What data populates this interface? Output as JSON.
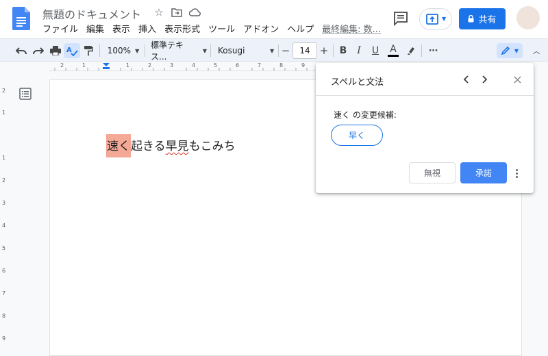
{
  "app": {
    "title": "無題のドキュメント",
    "menu": [
      "ファイル",
      "編集",
      "表示",
      "挿入",
      "表示形式",
      "ツール",
      "アドオン",
      "ヘルプ"
    ],
    "last_edit": "最終編集: 数...",
    "share_label": "共有",
    "accent_color": "#1a73e8"
  },
  "toolbar": {
    "zoom": "100%",
    "style": "標準テキス...",
    "font": "Kosugi",
    "font_size": "14",
    "icons": [
      "undo-icon",
      "redo-icon",
      "print-icon",
      "spellcheck-icon",
      "paint-format-icon",
      "bold-icon",
      "italic-icon",
      "underline-icon",
      "text-color-icon",
      "highlight-icon",
      "more-icon",
      "edit-mode-icon",
      "collapse-icon"
    ]
  },
  "ruler": {
    "h_numbers": [
      "2",
      "1",
      "1",
      "2",
      "3",
      "4",
      "5",
      "6",
      "7",
      "8",
      "9"
    ],
    "v_numbers": [
      "2",
      "1",
      "1",
      "2",
      "3",
      "4",
      "5",
      "6",
      "7",
      "8",
      "9"
    ]
  },
  "document": {
    "highlighted_word": "速く",
    "text_middle": "起きる",
    "underlined_word": "早見",
    "text_end": "もこみち"
  },
  "spell_panel": {
    "title": "スペルと文法",
    "label": "速く の変更候補:",
    "suggestion": "早く",
    "ignore_label": "無視",
    "accept_label": "承諾"
  }
}
